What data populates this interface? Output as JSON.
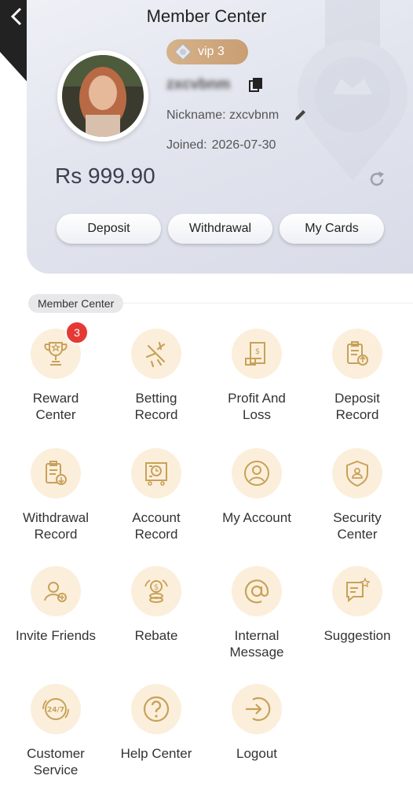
{
  "header": {
    "title": "Member Center"
  },
  "profile": {
    "vip_label": "vip 3",
    "username": "zxcvbnm",
    "nickname_text": "Nickname: zxcvbnm",
    "joined_label": "Joined:",
    "joined_date": "2026-07-30",
    "balance": "Rs 999.90"
  },
  "actions": {
    "deposit": "Deposit",
    "withdrawal": "Withdrawal",
    "my_cards": "My Cards"
  },
  "section": {
    "label": "Member Center"
  },
  "menu": [
    {
      "label": "Reward\nCenter",
      "icon": "trophy-icon",
      "badge": "3"
    },
    {
      "label": "Betting\nRecord",
      "icon": "betting-icon"
    },
    {
      "label": "Profit And\nLoss",
      "icon": "profit-icon"
    },
    {
      "label": "Deposit\nRecord",
      "icon": "deposit-record-icon"
    },
    {
      "label": "Withdrawal\nRecord",
      "icon": "withdrawal-record-icon"
    },
    {
      "label": "Account\nRecord",
      "icon": "account-record-icon"
    },
    {
      "label": "My Account",
      "icon": "my-account-icon"
    },
    {
      "label": "Security\nCenter",
      "icon": "shield-icon"
    },
    {
      "label": "Invite Friends",
      "icon": "invite-icon"
    },
    {
      "label": "Rebate",
      "icon": "rebate-icon"
    },
    {
      "label": "Internal\nMessage",
      "icon": "at-icon"
    },
    {
      "label": "Suggestion",
      "icon": "suggestion-icon"
    },
    {
      "label": "Customer\nService",
      "icon": "support-24-7-icon"
    },
    {
      "label": "Help Center",
      "icon": "question-icon"
    },
    {
      "label": "Logout",
      "icon": "logout-icon"
    }
  ],
  "colors": {
    "accent": "#c99e73",
    "icon_bg": "#fbefdb",
    "icon_stroke": "#c8a15a",
    "badge": "#e53935"
  }
}
